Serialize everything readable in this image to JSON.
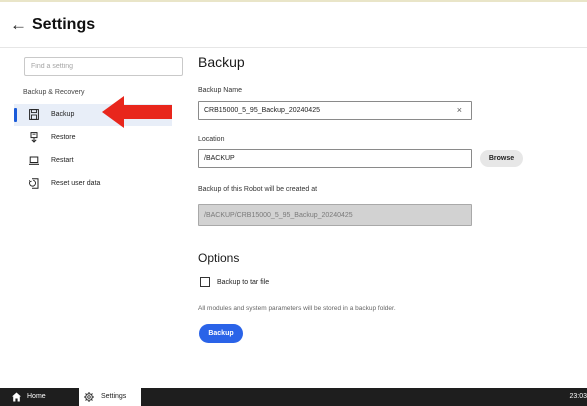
{
  "header": {
    "back_glyph": "←",
    "title": "Settings"
  },
  "sidebar": {
    "search_placeholder": "Find a setting",
    "section_title": "Backup & Recovery",
    "items": [
      {
        "label": "Backup",
        "icon": "save-icon",
        "active": true
      },
      {
        "label": "Restore",
        "icon": "restore-icon",
        "active": false
      },
      {
        "label": "Restart",
        "icon": "laptop-icon",
        "active": false
      },
      {
        "label": "Reset user data",
        "icon": "reset-icon",
        "active": false
      }
    ]
  },
  "main": {
    "heading": "Backup",
    "backup_name": {
      "label": "Backup Name",
      "value": "CRB15000_5_95_Backup_20240425",
      "clear_glyph": "×"
    },
    "location": {
      "label": "Location",
      "value": "/BACKUP",
      "browse_label": "Browse"
    },
    "created_at": {
      "label": "Backup of this Robot will be created at",
      "value": "/BACKUP/CRB15000_5_95_Backup_20240425"
    },
    "options_heading": "Options",
    "tar_checkbox": {
      "label": "Backup to tar file",
      "checked": false
    },
    "info_text": "All modules and system parameters will be stored in a backup folder.",
    "backup_button": "Backup"
  },
  "taskbar": {
    "home_label": "Home",
    "settings_label": "Settings",
    "clock": "23:03"
  },
  "colors": {
    "accent": "#2a63e8",
    "active_item_bg": "#e8eef8",
    "callout_arrow": "#e8261c",
    "taskbar_bg": "#1e1e1e"
  }
}
